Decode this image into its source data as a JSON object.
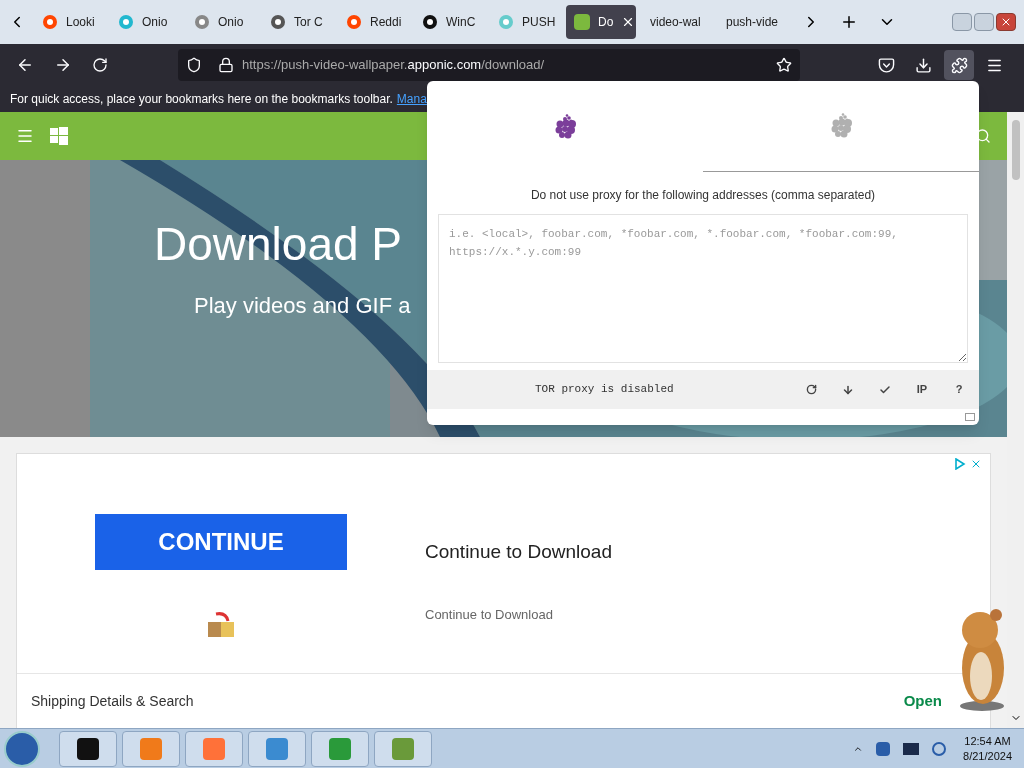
{
  "tabs": [
    {
      "label": "Looki",
      "selected": false
    },
    {
      "label": "Onio",
      "selected": false
    },
    {
      "label": "Onio",
      "selected": false
    },
    {
      "label": "Tor C",
      "selected": false
    },
    {
      "label": "Reddi",
      "selected": false
    },
    {
      "label": "WinC",
      "selected": false
    },
    {
      "label": "PUSH",
      "selected": false
    },
    {
      "label": "Do",
      "selected": true
    },
    {
      "label": "video-wal",
      "selected": false
    },
    {
      "label": "push-vide",
      "selected": false
    }
  ],
  "address_bar": {
    "url_prefix": "https://push-video-wallpaper.",
    "url_domain": "apponic.com",
    "url_path": "/download/"
  },
  "bookmarks_bar": {
    "message": "For quick access, place your bookmarks here on the bookmarks toolbar.",
    "link": "Mana"
  },
  "hero": {
    "title": "Download P",
    "subtitle": "Play videos and GIF a"
  },
  "ad": {
    "button": "CONTINUE",
    "title": "Continue to Download",
    "subtitle": "Continue to Download",
    "footer": "Shipping Details & Search",
    "open": "Open"
  },
  "popup": {
    "tabs": [
      {
        "selected": true
      },
      {
        "selected": false
      }
    ],
    "label": "Do not use proxy for the following addresses (comma separated)",
    "field": {
      "placeholder": "i.e. <local>, foobar.com, *foobar.com, *.foobar.com, *foobar.com:99, https://x.*.y.com:99"
    },
    "status": "TOR proxy is disabled",
    "actions": [
      {
        "kind": "reload"
      },
      {
        "kind": "download"
      },
      {
        "kind": "check"
      },
      {
        "kind": "text",
        "label": "IP"
      },
      {
        "kind": "text",
        "label": "?"
      }
    ]
  },
  "taskbar": {
    "time": "12:54 AM",
    "date": "8/21/2024"
  }
}
